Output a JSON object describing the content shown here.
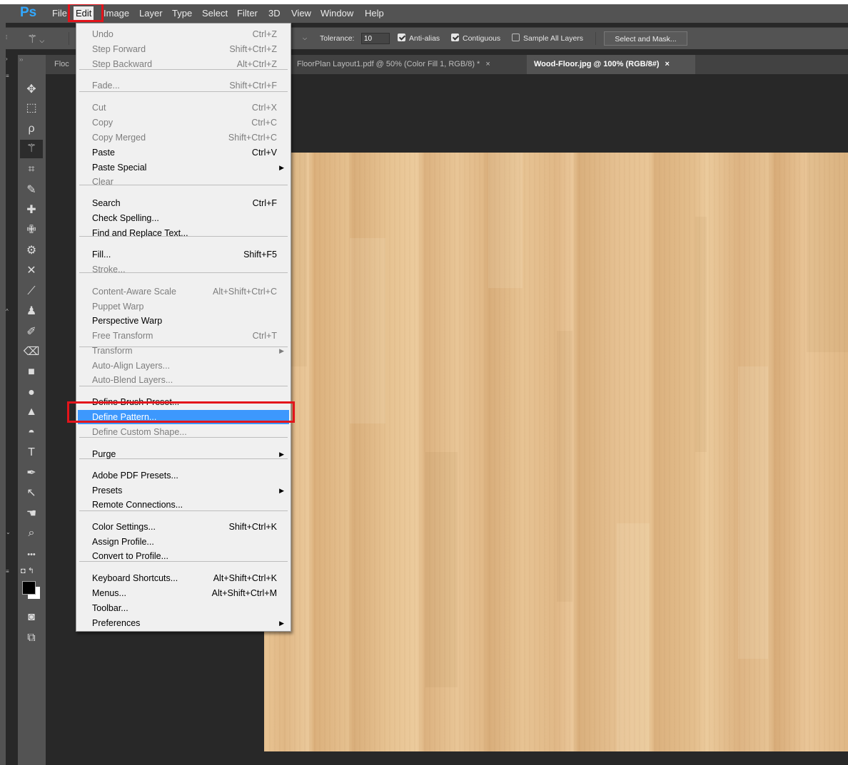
{
  "app": {
    "logo": "Ps"
  },
  "menubar": {
    "items": [
      "File",
      "Edit",
      "Image",
      "Layer",
      "Type",
      "Select",
      "Filter",
      "3D",
      "View",
      "Window",
      "Help"
    ],
    "active": "Edit"
  },
  "options": {
    "tolerance_label": "Tolerance:",
    "tolerance_value": "10",
    "anti_alias": {
      "label": "Anti-alias",
      "checked": true
    },
    "contiguous": {
      "label": "Contiguous",
      "checked": true
    },
    "sample_all": {
      "label": "Sample All Layers",
      "checked": false
    },
    "select_mask_label": "Select and Mask..."
  },
  "tabs": [
    {
      "label": "Floc"
    },
    {
      "label": "FloorPlan Layout1.pdf @ 50% (Color Fill 1, RGB/8) *"
    },
    {
      "label": "Wood-Floor.jpg @ 100% (RGB/8#)",
      "active": true
    }
  ],
  "tab_close_glyph": "×",
  "edit_menu": {
    "items": [
      {
        "label": "Undo",
        "shortcut": "Ctrl+Z",
        "disabled": true
      },
      {
        "label": "Step Forward",
        "shortcut": "Shift+Ctrl+Z",
        "disabled": true
      },
      {
        "label": "Step Backward",
        "shortcut": "Alt+Ctrl+Z",
        "disabled": true
      },
      {
        "label": "Fade...",
        "shortcut": "Shift+Ctrl+F",
        "disabled": true
      },
      {
        "label": "Cut",
        "shortcut": "Ctrl+X",
        "disabled": true
      },
      {
        "label": "Copy",
        "shortcut": "Ctrl+C",
        "disabled": true
      },
      {
        "label": "Copy Merged",
        "shortcut": "Shift+Ctrl+C",
        "disabled": true
      },
      {
        "label": "Paste",
        "shortcut": "Ctrl+V"
      },
      {
        "label": "Paste Special",
        "submenu": true
      },
      {
        "label": "Clear",
        "disabled": true
      },
      {
        "label": "Search",
        "shortcut": "Ctrl+F"
      },
      {
        "label": "Check Spelling..."
      },
      {
        "label": "Find and Replace Text..."
      },
      {
        "label": "Fill...",
        "shortcut": "Shift+F5"
      },
      {
        "label": "Stroke...",
        "disabled": true
      },
      {
        "label": "Content-Aware Scale",
        "shortcut": "Alt+Shift+Ctrl+C",
        "disabled": true
      },
      {
        "label": "Puppet Warp",
        "disabled": true
      },
      {
        "label": "Perspective Warp"
      },
      {
        "label": "Free Transform",
        "shortcut": "Ctrl+T",
        "disabled": true
      },
      {
        "label": "Transform",
        "submenu": true,
        "disabled": true
      },
      {
        "label": "Auto-Align Layers...",
        "disabled": true
      },
      {
        "label": "Auto-Blend Layers...",
        "disabled": true
      },
      {
        "label": "Define Brush Preset..."
      },
      {
        "label": "Define Pattern...",
        "highlighted": true
      },
      {
        "label": "Define Custom Shape...",
        "disabled": true
      },
      {
        "label": "Purge",
        "submenu": true
      },
      {
        "label": "Adobe PDF Presets..."
      },
      {
        "label": "Presets",
        "submenu": true
      },
      {
        "label": "Remote Connections..."
      },
      {
        "label": "Color Settings...",
        "shortcut": "Shift+Ctrl+K"
      },
      {
        "label": "Assign Profile..."
      },
      {
        "label": "Convert to Profile..."
      },
      {
        "label": "Keyboard Shortcuts...",
        "shortcut": "Alt+Shift+Ctrl+K"
      },
      {
        "label": "Menus...",
        "shortcut": "Alt+Shift+Ctrl+M"
      },
      {
        "label": "Toolbar..."
      },
      {
        "label": "Preferences",
        "submenu": true
      }
    ]
  },
  "tools": [
    {
      "name": "move-tool-icon",
      "glyph": "✥"
    },
    {
      "name": "marquee-tool-icon",
      "glyph": "⬚"
    },
    {
      "name": "lasso-tool-icon",
      "glyph": "ρ"
    },
    {
      "name": "magic-wand-tool-icon",
      "glyph": "⚚",
      "selected": true
    },
    {
      "name": "crop-tool-icon",
      "glyph": "⌗"
    },
    {
      "name": "eyedropper-tool-icon",
      "glyph": "✎"
    },
    {
      "name": "spot-healing-tool-icon",
      "glyph": "✚"
    },
    {
      "name": "healing-brush-tool-icon",
      "glyph": "✙"
    },
    {
      "name": "patch-tool-icon",
      "glyph": "⚙"
    },
    {
      "name": "content-aware-move-tool-icon",
      "glyph": "✕"
    },
    {
      "name": "brush-tool-icon",
      "glyph": "⟋"
    },
    {
      "name": "clone-stamp-tool-icon",
      "glyph": "♟"
    },
    {
      "name": "history-brush-tool-icon",
      "glyph": "✐"
    },
    {
      "name": "eraser-tool-icon",
      "glyph": "⌫"
    },
    {
      "name": "gradient-tool-icon",
      "glyph": "■"
    },
    {
      "name": "blur-tool-icon",
      "glyph": "●"
    },
    {
      "name": "sharpen-tool-icon",
      "glyph": "▲"
    },
    {
      "name": "dodge-tool-icon",
      "glyph": "◓"
    },
    {
      "name": "type-tool-icon",
      "glyph": "T"
    },
    {
      "name": "pen-tool-icon",
      "glyph": "✒"
    },
    {
      "name": "path-selection-tool-icon",
      "glyph": "↖"
    },
    {
      "name": "hand-tool-icon",
      "glyph": "☚"
    },
    {
      "name": "zoom-tool-icon",
      "glyph": "⌕"
    },
    {
      "name": "more-tools-icon",
      "glyph": "•••"
    }
  ],
  "bottom_tools": [
    {
      "name": "quick-mask-icon",
      "glyph": "◙"
    },
    {
      "name": "screen-mode-icon",
      "glyph": "⧉"
    }
  ],
  "colors": {
    "accent": "#3d98fd",
    "highlight_box": "#e3141b",
    "ps_blue": "#31a8ff"
  }
}
